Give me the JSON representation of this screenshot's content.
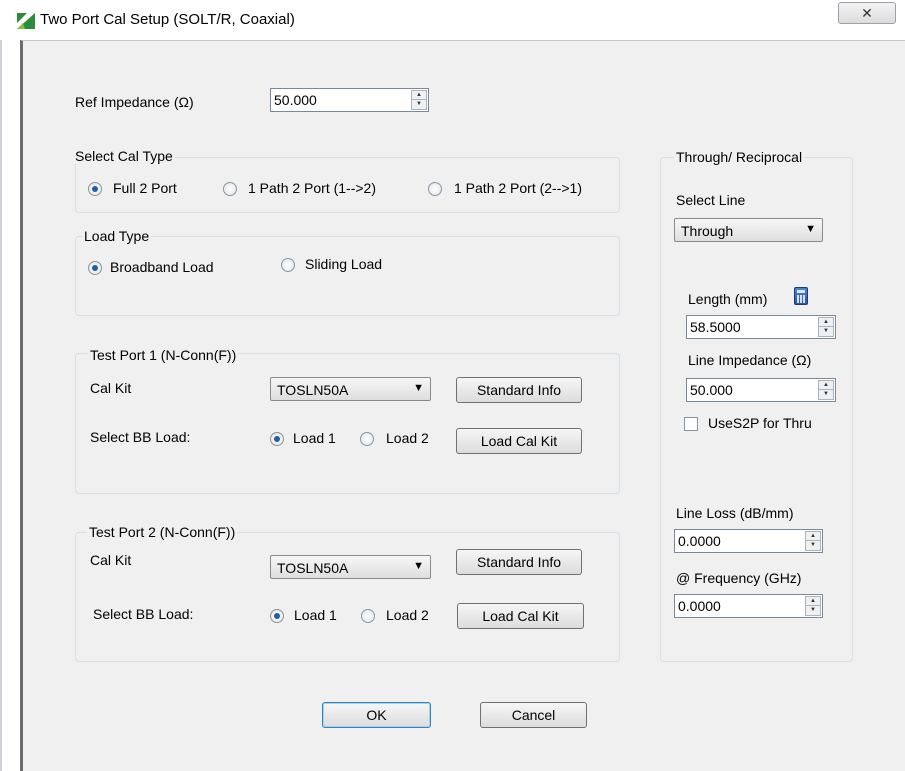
{
  "window": {
    "title": "Two Port Cal Setup (SOLT/R, Coaxial)",
    "close_glyph": "✕"
  },
  "ref_impedance": {
    "label": "Ref Impedance (Ω)",
    "value": "50.000"
  },
  "cal_type": {
    "group_label": "Select Cal Type",
    "options": [
      "Full 2 Port",
      "1 Path 2 Port (1-->2)",
      "1 Path 2 Port (2-->1)"
    ],
    "selected": "Full 2 Port"
  },
  "load_type": {
    "group_label": "Load Type",
    "options": [
      "Broadband Load",
      "Sliding Load"
    ],
    "selected": "Broadband Load"
  },
  "test_port_1": {
    "group_label": "Test Port 1 (N-Conn(F))",
    "cal_kit_label": "Cal Kit",
    "cal_kit_value": "TOSLN50A",
    "standard_info_label": "Standard Info",
    "bb_load_label": "Select BB Load:",
    "load_options": [
      "Load 1",
      "Load 2"
    ],
    "selected_load": "Load 1",
    "load_cal_kit_label": "Load Cal Kit"
  },
  "test_port_2": {
    "group_label": "Test Port 2 (N-Conn(F))",
    "cal_kit_label": "Cal Kit",
    "cal_kit_value": "TOSLN50A",
    "standard_info_label": "Standard Info",
    "bb_load_label": "Select BB Load:",
    "load_options": [
      "Load 1",
      "Load 2"
    ],
    "selected_load": "Load 1",
    "load_cal_kit_label": "Load Cal Kit"
  },
  "through": {
    "group_label": "Through/ Reciprocal",
    "select_line_label": "Select Line",
    "select_line_value": "Through",
    "length_label": "Length (mm)",
    "length_value": "58.5000",
    "line_impedance_label": "Line Impedance (Ω)",
    "line_impedance_value": "50.000",
    "use_s2p_label": "UseS2P for Thru",
    "use_s2p_checked": false,
    "line_loss_label": "Line Loss (dB/mm)",
    "line_loss_value": "0.0000",
    "frequency_label": "@ Frequency (GHz)",
    "frequency_value": "0.0000"
  },
  "footer": {
    "ok_label": "OK",
    "cancel_label": "Cancel"
  },
  "colors": {
    "frame_bg": "#f0f0f0",
    "group_border": "#d5dfe5",
    "radio_dot": "#1e5fa8",
    "title_icon": "#2e8b3a"
  }
}
